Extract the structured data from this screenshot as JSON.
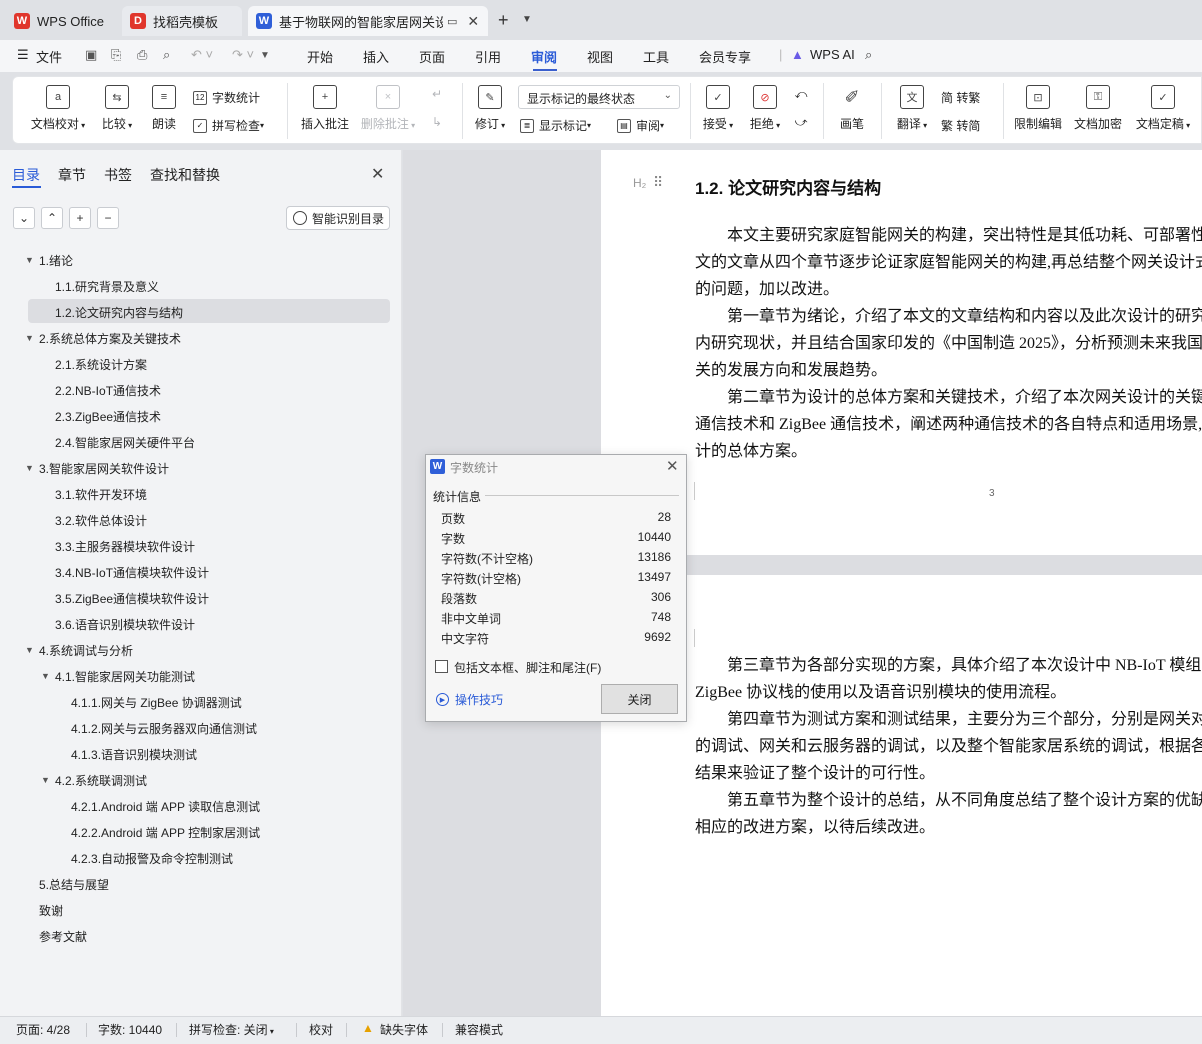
{
  "titlebar": {
    "tabs": [
      {
        "label": "WPS Office"
      },
      {
        "label": "找稻壳模板"
      },
      {
        "label": "基于物联网的智能家居网关设计"
      }
    ]
  },
  "menubar": {
    "file": "文件",
    "items": [
      "开始",
      "插入",
      "页面",
      "引用",
      "审阅",
      "视图",
      "工具",
      "会员专享"
    ],
    "active": "审阅",
    "ai": "WPS AI"
  },
  "ribbon": {
    "doc_check": "文档校对",
    "compare": "比较",
    "read_aloud": "朗读",
    "word_count": "字数统计",
    "spell_check": "拼写检查",
    "insert_comment": "插入批注",
    "delete_comment": "删除批注",
    "revise": "修订",
    "markup_state": "显示标记的最终状态",
    "show_markup": "显示标记",
    "review": "审阅",
    "accept": "接受",
    "reject": "拒绝",
    "pen": "画笔",
    "translate": "翻译",
    "to_trad": "简 转繁",
    "to_simp": "繁 转简",
    "restrict": "限制编辑",
    "encrypt": "文档加密",
    "finalize": "文档定稿"
  },
  "nav": {
    "tabs": [
      "目录",
      "章节",
      "书签",
      "查找和替换"
    ],
    "smart_toc": "智能识别目录",
    "toc": [
      {
        "label": "1.绪论"
      },
      {
        "label": "1.1.研究背景及意义"
      },
      {
        "label": "1.2.论文研究内容与结构"
      },
      {
        "label": "2.系统总体方案及关键技术"
      },
      {
        "label": "2.1.系统设计方案"
      },
      {
        "label": "2.2.NB-IoT通信技术"
      },
      {
        "label": "2.3.ZigBee通信技术"
      },
      {
        "label": "2.4.智能家居网关硬件平台"
      },
      {
        "label": "3.智能家居网关软件设计"
      },
      {
        "label": "3.1.软件开发环境"
      },
      {
        "label": "3.2.软件总体设计"
      },
      {
        "label": "3.3.主服务器模块软件设计"
      },
      {
        "label": "3.4.NB-IoT通信模块软件设计"
      },
      {
        "label": "3.5.ZigBee通信模块软件设计"
      },
      {
        "label": "3.6.语音识别模块软件设计"
      },
      {
        "label": "4.系统调试与分析"
      },
      {
        "label": "4.1.智能家居网关功能测试"
      },
      {
        "label": "4.1.1.网关与 ZigBee 协调器测试"
      },
      {
        "label": "4.1.2.网关与云服务器双向通信测试"
      },
      {
        "label": "4.1.3.语音识别模块测试"
      },
      {
        "label": "4.2.系统联调测试"
      },
      {
        "label": "4.2.1.Android 端 APP 读取信息测试"
      },
      {
        "label": "4.2.2.Android 端 APP 控制家居测试"
      },
      {
        "label": "4.2.3.自动报警及命令控制测试"
      },
      {
        "label": "5.总结与展望"
      },
      {
        "label": "致谢"
      },
      {
        "label": "参考文献"
      }
    ]
  },
  "document": {
    "heading_mark": "H₂",
    "heading": "1.2.  论文研究内容与结构",
    "page1_lines": [
      "本文主要研究家庭智能网关的构建，突出特性是其低功耗、可部署性",
      "文的文章从四个章节逐步论证家庭智能网关的构建,再总结整个网关设计式",
      "的问题，加以改进。",
      "第一章节为绪论，介绍了本文的文章结构和内容以及此次设计的研究",
      "内研究现状，并且结合国家印发的《中国制造 2025》，分析预测未来我国",
      "关的发展方向和发展趋势。",
      "第二章节为设计的总体方案和关键技术，介绍了本次网关设计的关键",
      "通信技术和 ZigBee 通信技术，阐述两种通信技术的各自特点和适用场景,",
      "计的总体方案。"
    ],
    "page_number": "3",
    "page2_lines": [
      "第三章节为各部分实现的方案，具体介绍了本次设计中 NB-IoT 模组",
      "ZigBee 协议栈的使用以及语音识别模块的使用流程。",
      "第四章节为测试方案和测试结果，主要分为三个部分，分别是网关对",
      "的调试、网关和云服务器的调试，以及整个智能家居系统的调试，根据各个",
      "结果来验证了整个设计的可行性。",
      "第五章节为整个设计的总结，从不同角度总结了整个设计方案的优缺",
      "相应的改进方案，以待后续改进。"
    ]
  },
  "dialog": {
    "title": "字数统计",
    "section": "统计信息",
    "stats": [
      {
        "label": "页数",
        "value": "28"
      },
      {
        "label": "字数",
        "value": "10440"
      },
      {
        "label": "字符数(不计空格)",
        "value": "13186"
      },
      {
        "label": "字符数(计空格)",
        "value": "13497"
      },
      {
        "label": "段落数",
        "value": "306"
      },
      {
        "label": "非中文单词",
        "value": "748"
      },
      {
        "label": "中文字符",
        "value": "9692"
      }
    ],
    "include_label": "包括文本框、脚注和尾注(F)",
    "tips": "操作技巧",
    "close": "关闭"
  },
  "statusbar": {
    "page": "页面: 4/28",
    "words": "字数: 10440",
    "spell": "拼写检查: 关闭",
    "proof": "校对",
    "missing_font": "缺失字体",
    "compat": "兼容模式"
  },
  "colors": {
    "accent": "#2a5bd7",
    "wps_red": "#e0362c"
  }
}
